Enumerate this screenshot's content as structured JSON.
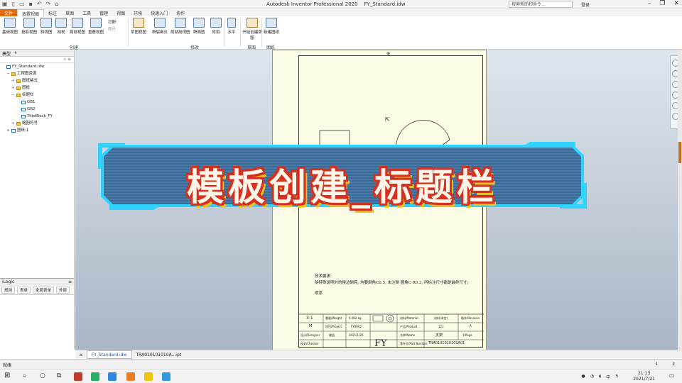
{
  "window": {
    "title": "Autodesk Inventor Professional 2020    FY_Standard.idw",
    "search_placeholder": "搜索帮助和命令...",
    "login": "登录"
  },
  "menu": [
    "文件",
    "放置视图",
    "标注",
    "草图",
    "工具",
    "管理",
    "视图",
    "环境",
    "快速入门",
    "协作"
  ],
  "ribbon": {
    "create_buttons": [
      {
        "label": "基础视图"
      },
      {
        "label": "投影视图"
      },
      {
        "label": "斜视图"
      },
      {
        "label": "剖视"
      },
      {
        "label": "局部视图"
      },
      {
        "label": "重叠视图"
      }
    ],
    "small_buttons": [
      "打断",
      "断开"
    ],
    "modify_buttons": [
      {
        "label": "草图视图"
      },
      {
        "label": "断裂画法"
      },
      {
        "label": "局部剖视图"
      },
      {
        "label": "断面图"
      },
      {
        "label": "修剪"
      }
    ],
    "align_label": "水平",
    "sketch_button": "开始创建草图",
    "sheet_button": "新建图纸",
    "groups": {
      "create": "创建",
      "modify": "修改",
      "sketch": "草图",
      "sheets": "图纸"
    }
  },
  "browser": {
    "tab": "模型",
    "items": [
      {
        "label": "FY_Standard.idw",
        "indent": 0,
        "icon": "document-icon"
      },
      {
        "label": "工程图资源",
        "indent": 1,
        "icon": "folder-icon",
        "expand": "−"
      },
      {
        "label": "图纸格式",
        "indent": 2,
        "icon": "folder-icon",
        "expand": "+"
      },
      {
        "label": "图框",
        "indent": 2,
        "icon": "folder-icon",
        "expand": "+"
      },
      {
        "label": "标题栏",
        "indent": 2,
        "icon": "folder-icon",
        "expand": "−"
      },
      {
        "label": "GB1",
        "indent": 3,
        "icon": "document-icon"
      },
      {
        "label": "GB2",
        "indent": 3,
        "icon": "document-icon"
      },
      {
        "label": "TitleBlock_FY",
        "indent": 3,
        "icon": "document-icon"
      },
      {
        "label": "略图符号",
        "indent": 2,
        "icon": "folder-icon",
        "expand": "+"
      },
      {
        "label": "图纸:1",
        "indent": 1,
        "icon": "document-icon",
        "expand": "+"
      }
    ]
  },
  "properties": {
    "title": "iLogic",
    "tabs": [
      "规则",
      "表单",
      "全局表单",
      "外部"
    ]
  },
  "drawing": {
    "notes_title": "技术要求:",
    "notes_line1": "除特殊说明外的棱边倒钝, 均要倒角C0.5, 未注倒 圆角C R0.3, 所标注尺寸都是最终尺寸;",
    "notes_line2": "喷漆",
    "title_block": {
      "scale": "3:1",
      "weight_label": "重量/Weight",
      "weight": "0.002 kg",
      "material_label": "材料/Material",
      "material": "材料(未定)",
      "revision_label": "版本/Revision",
      "revision": "A",
      "unit_m": "M",
      "project_label": "项目/Project",
      "project": "FY0002",
      "product_label": "产品/Product",
      "product": "121",
      "designer_label": "设计/Designer",
      "designer": "晓旭",
      "date": "2021/1/26",
      "name_label": "名称/Name",
      "name": "支架",
      "page_label": "1/Page",
      "checker_label": "校对/Checker",
      "logo": "FY",
      "partnum_label": "零件号/Part Number",
      "partnum": "TRA0101010101A01"
    }
  },
  "banner": {
    "title": "模板创建_标题栏"
  },
  "doc_tabs": [
    "FY_Standard.idw",
    "TRA010101010A...ipt"
  ],
  "status": {
    "text": "就绪",
    "page1": "1",
    "page2": "2"
  },
  "clock": {
    "time": "21:13",
    "date": "2021/7/21"
  },
  "tray": {
    "ime": "中",
    "s": "S"
  }
}
